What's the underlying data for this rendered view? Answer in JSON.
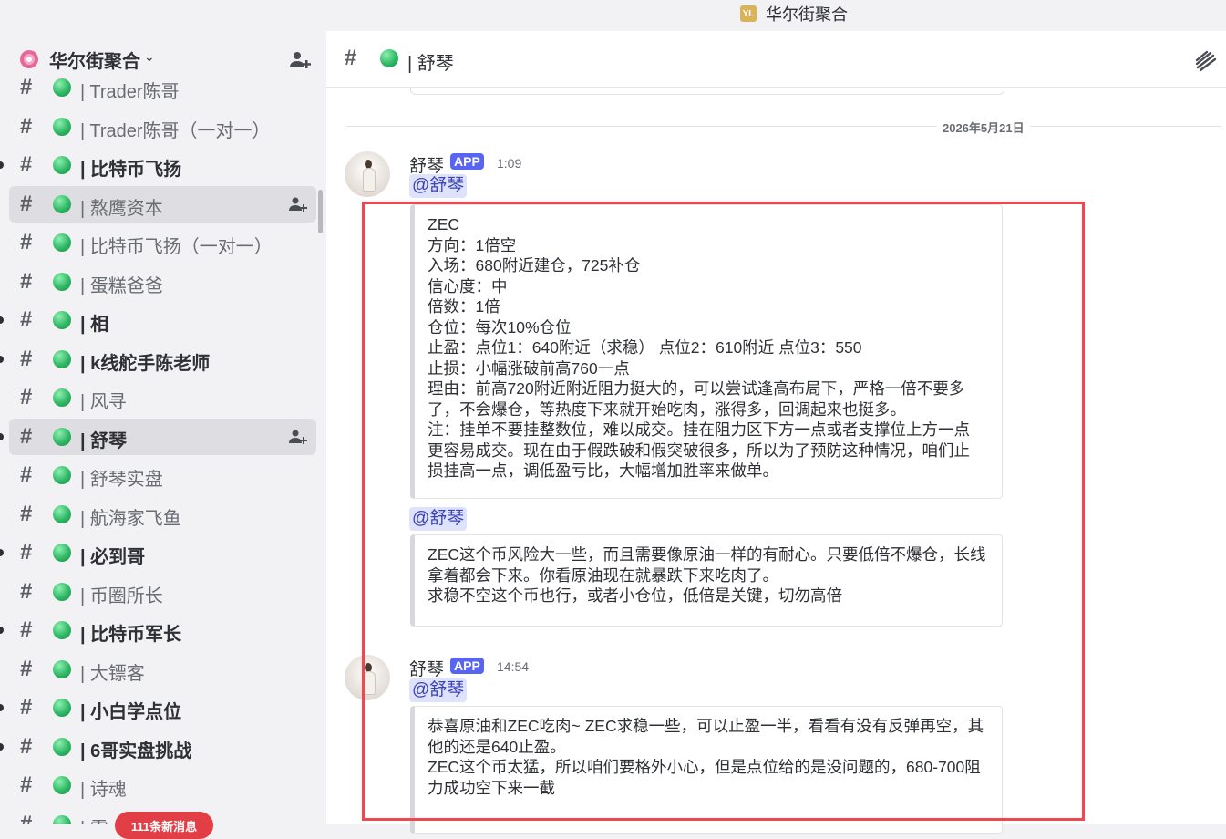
{
  "window": {
    "title": "华尔街聚合",
    "logo_text": "YL"
  },
  "sidebar": {
    "server_name": "华尔街聚合",
    "new_messages_badge": "111条新消息",
    "channels": [
      {
        "label": "| Trader陈哥",
        "unread": false,
        "active": false
      },
      {
        "label": "| Trader陈哥（一对一）",
        "unread": false,
        "active": false
      },
      {
        "label": "| 比特币飞扬",
        "unread": true,
        "active": false
      },
      {
        "label": "| 熬鹰资本",
        "unread": false,
        "active": true
      },
      {
        "label": "| 比特币飞扬（一对一）",
        "unread": false,
        "active": false
      },
      {
        "label": "| 蛋糕爸爸",
        "unread": false,
        "active": false
      },
      {
        "label": "| 相",
        "unread": true,
        "active": false
      },
      {
        "label": "| k线舵手陈老师",
        "unread": true,
        "active": false
      },
      {
        "label": "| 风寻",
        "unread": false,
        "active": false
      },
      {
        "label": "| 舒琴",
        "unread": true,
        "active": true
      },
      {
        "label": "| 舒琴实盘",
        "unread": false,
        "active": false
      },
      {
        "label": "| 航海家飞鱼",
        "unread": false,
        "active": false
      },
      {
        "label": "| 必到哥",
        "unread": true,
        "active": false
      },
      {
        "label": "| 币圈所长",
        "unread": false,
        "active": false
      },
      {
        "label": "| 比特币军长",
        "unread": true,
        "active": false
      },
      {
        "label": "| 大镖客",
        "unread": false,
        "active": false
      },
      {
        "label": "| 小白学点位",
        "unread": true,
        "active": false
      },
      {
        "label": "| 6哥实盘挑战",
        "unread": true,
        "active": false
      },
      {
        "label": "| 诗魂",
        "unread": false,
        "active": false
      },
      {
        "label": "| 雷",
        "unread": false,
        "active": false
      }
    ]
  },
  "channel_header": {
    "title": "| 舒琴"
  },
  "date_divider": "2026年5月21日",
  "messages": [
    {
      "author": "舒琴",
      "tag": "APP",
      "time": "1:09",
      "blocks": [
        {
          "mention": "@舒琴",
          "lines": [
            "ZEC",
            "方向：1倍空",
            "入场：680附近建仓，725补仓",
            "信心度：中",
            "倍数：1倍",
            "仓位：每次10%仓位",
            "止盈：点位1：640附近（求稳） 点位2：610附近 点位3：550",
            "止损：小幅涨破前高760一点",
            "理由：前高720附近附近阻力挺大的，可以尝试逢高布局下，严格一倍不要多",
            "了，不会爆仓，等热度下来就开始吃肉，涨得多，回调起来也挺多。",
            "注：挂单不要挂整数位，难以成交。挂在阻力区下方一点或者支撑位上方一点",
            "更容易成交。现在由于假跌破和假突破很多，所以为了预防这种情况，咱们止",
            "损挂高一点，调低盈亏比，大幅增加胜率来做单。"
          ]
        },
        {
          "mention": "@舒琴",
          "lines": [
            "ZEC这个币风险大一些，而且需要像原油一样的有耐心。只要低倍不爆仓，长线",
            "拿着都会下来。你看原油现在就暴跌下来吃肉了。",
            "求稳不空这个币也行，或者小仓位，低倍是关键，切勿高倍"
          ]
        }
      ]
    },
    {
      "author": "舒琴",
      "tag": "APP",
      "time": "14:54",
      "blocks": [
        {
          "mention": "@舒琴",
          "lines": [
            "恭喜原油和ZEC吃肉~ ZEC求稳一些，可以止盈一半，看看有没有反弹再空，其",
            "他的还是640止盈。",
            "ZEC这个币太猛，所以咱们要格外小心，但是点位给的是没问题的，680-700阻",
            "力成功空下来一截"
          ]
        }
      ]
    }
  ]
}
